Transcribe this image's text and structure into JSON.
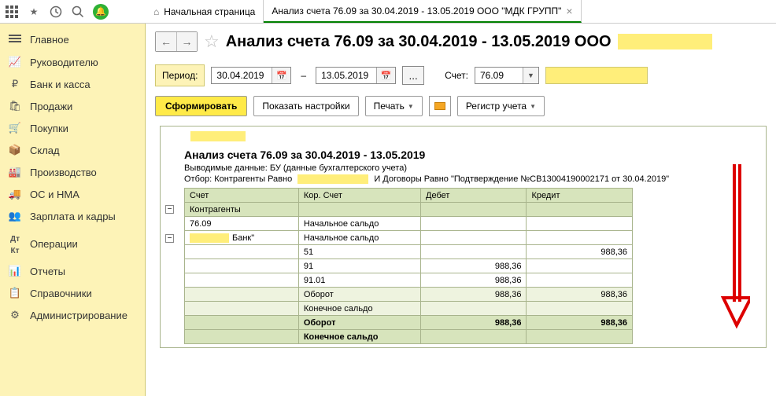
{
  "tabs": {
    "home": "Начальная страница",
    "active": "Анализ счета 76.09 за 30.04.2019 - 13.05.2019 ООО \"МДК ГРУПП\""
  },
  "sidebar": [
    {
      "icon": "menu",
      "label": "Главное"
    },
    {
      "icon": "chart",
      "label": "Руководителю"
    },
    {
      "icon": "ruble",
      "label": "Банк и касса"
    },
    {
      "icon": "bag",
      "label": "Продажи"
    },
    {
      "icon": "cart",
      "label": "Покупки"
    },
    {
      "icon": "box",
      "label": "Склад"
    },
    {
      "icon": "factory",
      "label": "Производство"
    },
    {
      "icon": "truck",
      "label": "ОС и НМА"
    },
    {
      "icon": "people",
      "label": "Зарплата и кадры"
    },
    {
      "icon": "ops",
      "label": "Операции"
    },
    {
      "icon": "bars",
      "label": "Отчеты"
    },
    {
      "icon": "book",
      "label": "Справочники"
    },
    {
      "icon": "gear",
      "label": "Администрирование"
    }
  ],
  "page_title": "Анализ счета 76.09 за 30.04.2019 - 13.05.2019 ООО",
  "period": {
    "label": "Период:",
    "from": "30.04.2019",
    "to": "13.05.2019",
    "account_label": "Счет:",
    "account": "76.09"
  },
  "actions": {
    "generate": "Сформировать",
    "settings": "Показать настройки",
    "print": "Печать",
    "register": "Регистр учета"
  },
  "report": {
    "title": "Анализ счета 76.09 за 30.04.2019 - 13.05.2019",
    "data_label": "Выводимые данные:",
    "data_value": "БУ (данные бухгалтерского учета)",
    "filter_label": "Отбор:",
    "filter1": "Контрагенты Равно",
    "filter2": "И Договоры Равно \"Подтверждение №СВ13004190002171 от 30.04.2019\"",
    "headers": {
      "account": "Счет",
      "sub": "Контрагенты",
      "cor": "Кор. Счет",
      "debit": "Дебет",
      "credit": "Кредит"
    },
    "rows": [
      {
        "acc": "76.09",
        "cor": "Начальное сальдо",
        "debit": "",
        "credit": ""
      },
      {
        "acc": "Банк\"",
        "cor": "Начальное сальдо",
        "debit": "",
        "credit": "",
        "mask": true
      },
      {
        "acc": "",
        "cor": "51",
        "debit": "",
        "credit": "988,36"
      },
      {
        "acc": "",
        "cor": "91",
        "debit": "988,36",
        "credit": ""
      },
      {
        "acc": "",
        "cor": "91.01",
        "debit": "988,36",
        "credit": ""
      },
      {
        "acc": "",
        "cor": "Оборот",
        "debit": "988,36",
        "credit": "988,36",
        "sub": true
      },
      {
        "acc": "",
        "cor": "Конечное сальдо",
        "debit": "",
        "credit": "",
        "sub": true
      },
      {
        "acc": "",
        "cor": "Оборот",
        "debit": "988,36",
        "credit": "988,36",
        "total": true
      },
      {
        "acc": "",
        "cor": "Конечное сальдо",
        "debit": "",
        "credit": "",
        "total": true
      }
    ]
  }
}
